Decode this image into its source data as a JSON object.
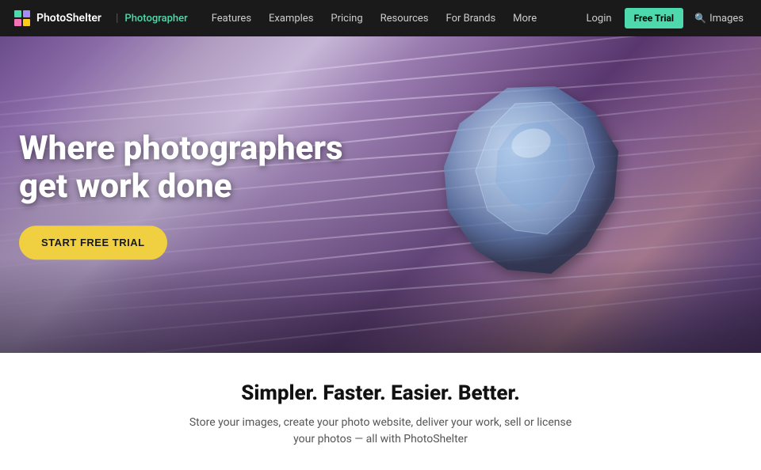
{
  "nav": {
    "logo_text": "PhotoShelter",
    "divider": "|",
    "sub_label": "Photographer",
    "links": [
      {
        "label": "Features",
        "id": "features"
      },
      {
        "label": "Examples",
        "id": "examples"
      },
      {
        "label": "Pricing",
        "id": "pricing"
      },
      {
        "label": "Resources",
        "id": "resources"
      },
      {
        "label": "For Brands",
        "id": "for-brands"
      },
      {
        "label": "More",
        "id": "more"
      }
    ],
    "login_label": "Login",
    "free_trial_label": "Free Trial",
    "images_label": "Images"
  },
  "hero": {
    "heading_line1": "Where photographers",
    "heading_line2": "get work done",
    "cta_label": "START FREE TRIAL"
  },
  "tagline": {
    "heading": "Simpler. Faster. Easier. Better.",
    "subtext": "Store your images, create your photo website, deliver your work, sell or license your photos — all with PhotoShelter"
  }
}
